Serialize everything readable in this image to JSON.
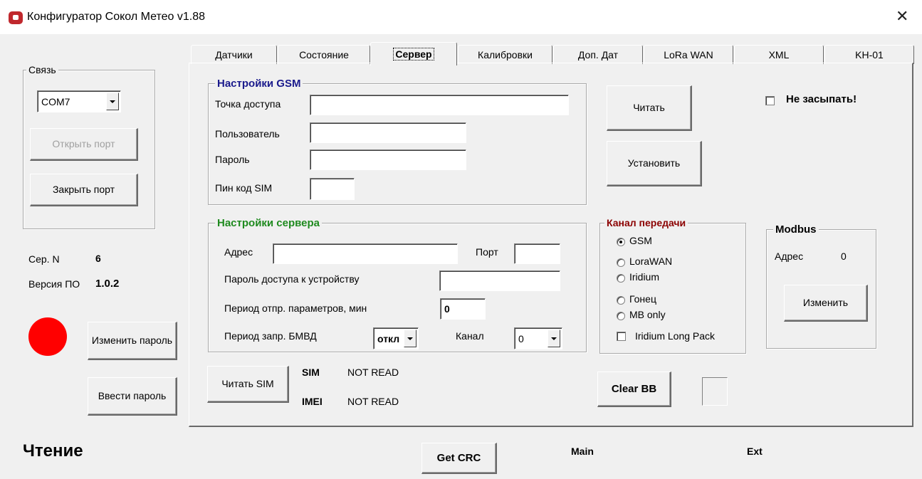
{
  "window": {
    "title": "Конфигуратор Сокол Метео v1.88",
    "close_glyph": "✕"
  },
  "connection": {
    "group_title": "Связь",
    "port_value": "COM7",
    "open_port": "Открыть порт",
    "close_port": "Закрыть порт"
  },
  "device": {
    "serial_label": "Сер. N",
    "serial_value": "6",
    "fw_label": "Версия ПО",
    "fw_value": "1.0.2",
    "status_color": "#ff0000",
    "change_password": "Изменить пароль",
    "enter_password": "Ввести пароль",
    "mode": "Чтение"
  },
  "tabs": [
    "Датчики",
    "Состояние",
    "Сервер",
    "Калибровки",
    "Доп. Дат",
    "LoRa WAN",
    "XML",
    "KH-01"
  ],
  "active_tab": "Сервер",
  "gsm": {
    "title": "Настройки GSM",
    "title_color": "#1a1a8c",
    "apn_label": "Точка доступа",
    "apn_value": "",
    "user_label": "Пользователь",
    "user_value": "",
    "password_label": "Пароль",
    "password_value": "",
    "pin_label": "Пин код SIM",
    "pin_value": ""
  },
  "server": {
    "title": "Настройки сервера",
    "title_color": "#1f8a1f",
    "address_label": "Адрес",
    "address_value": "",
    "port_label": "Порт",
    "port_value": "",
    "device_password_label": "Пароль доступа к устройству",
    "device_password_value": "",
    "send_period_label": "Период отпр. параметров, мин",
    "send_period_value": "0",
    "bmvd_label": "Период запр. БМВД",
    "bmvd_value": "откл",
    "channel_label": "Канал",
    "channel_value": "0"
  },
  "actions": {
    "read": "Читать",
    "set": "Установить",
    "no_sleep": "Не засыпать!",
    "read_sim": "Читать SIM",
    "clear_bb": "Clear BB",
    "get_crc": "Get CRC"
  },
  "sim": {
    "sim_label": "SIM",
    "sim_value": "NOT READ",
    "imei_label": "IMEI",
    "imei_value": "NOT READ"
  },
  "transmission": {
    "title": "Канал передачи",
    "title_color": "#8b0000",
    "options": [
      "GSM",
      "LoraWAN",
      "Iridium",
      "Гонец",
      "MB only"
    ],
    "selected": "GSM",
    "long_pack": "Iridium Long Pack"
  },
  "modbus": {
    "title": "Modbus",
    "address_label": "Адрес",
    "address_value": "0",
    "change": "Изменить"
  },
  "crc": {
    "main_label": "Main",
    "ext_label": "Ext"
  }
}
